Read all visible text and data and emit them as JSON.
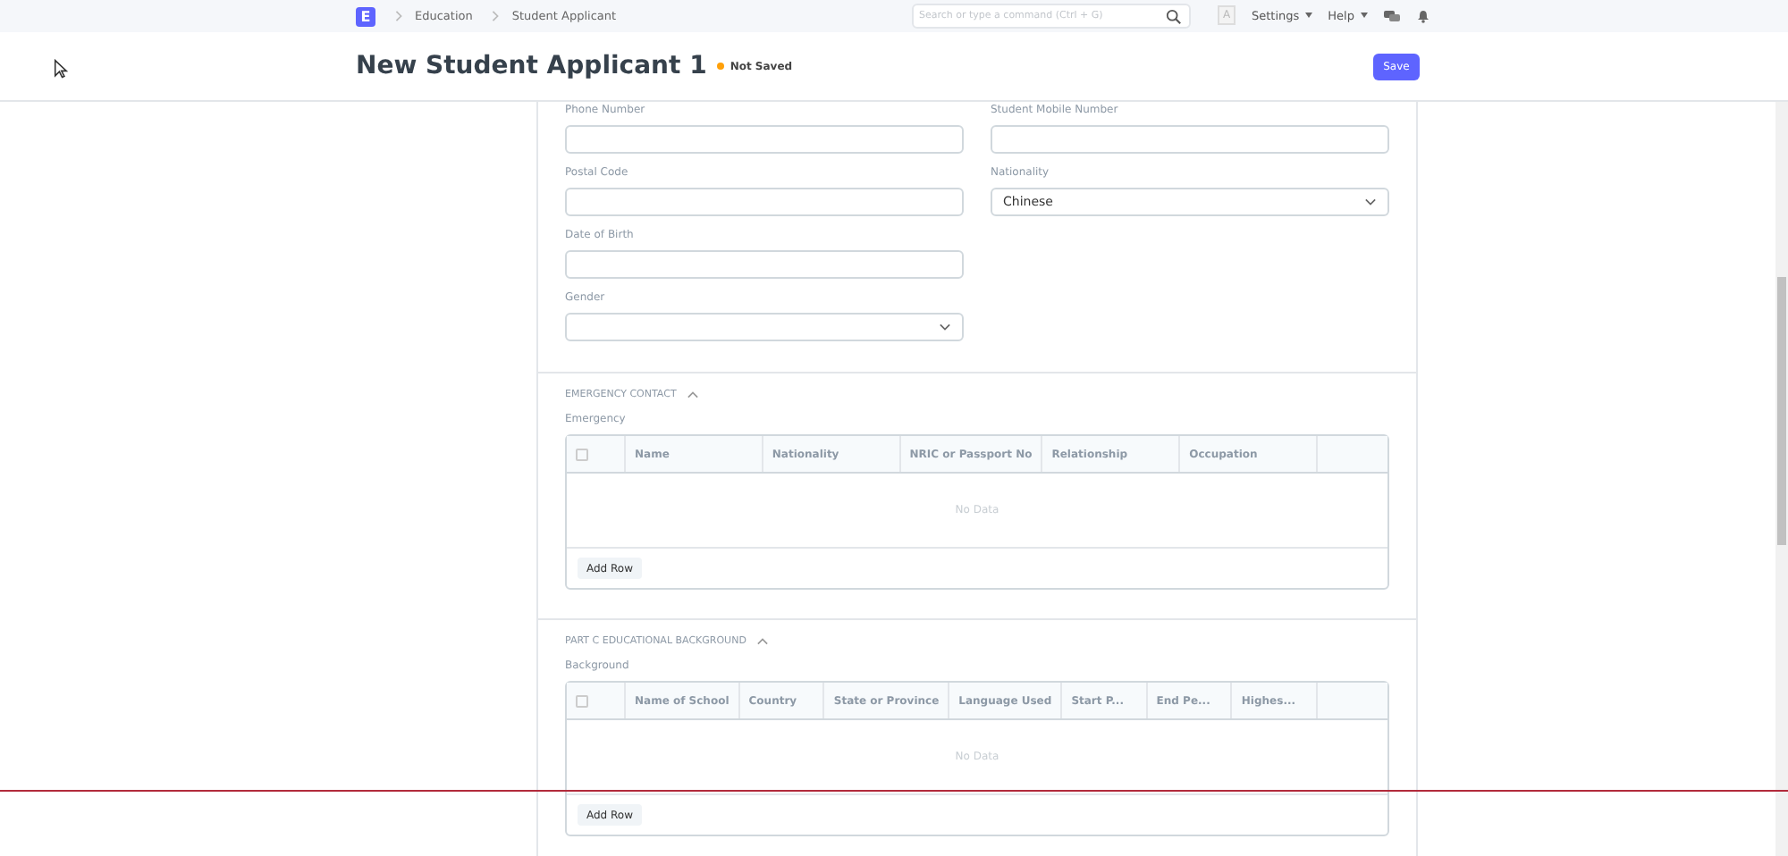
{
  "navbar": {
    "logo": "E",
    "breadcrumbs": [
      "Education",
      "Student Applicant"
    ],
    "search": {
      "placeholder": "Search or type a command (Ctrl + G)"
    },
    "avatar": "A",
    "menus": [
      "Settings",
      "Help"
    ]
  },
  "page_head": {
    "title": "New Student Applicant 1",
    "indicator": "Not Saved",
    "primary_button": "Save"
  },
  "fields": [
    {
      "label": "Phone Number",
      "kind": "text"
    },
    {
      "label": "Student Mobile Number",
      "kind": "text"
    },
    {
      "label": "Postal Code",
      "kind": "text"
    },
    {
      "label": "Nationality",
      "kind": "select",
      "value": "Chinese"
    },
    {
      "label": "Date of Birth",
      "kind": "text"
    },
    {
      "kind": "spacer"
    },
    {
      "label": "Gender",
      "kind": "select"
    }
  ],
  "sections": [
    {
      "title": "EMERGENCY CONTACT",
      "expanded": true,
      "table_label": "Emergency",
      "select_all_checked": false,
      "columns": [
        "Name",
        "Nationality",
        "NRIC or Passport No",
        "Relationship",
        "Occupation"
      ],
      "empty_text": "No Data",
      "add_button": "Add Row"
    },
    {
      "title": "PART C EDUCATIONAL BACKGROUND",
      "expanded": true,
      "table_label": "Background",
      "select_all_checked": false,
      "columns": [
        "Name of School",
        "Country",
        "State or Province",
        "Language Used",
        "Start P...",
        "End Pe...",
        "Highes..."
      ],
      "empty_text": "No Data",
      "add_button": "Add Row"
    }
  ]
}
